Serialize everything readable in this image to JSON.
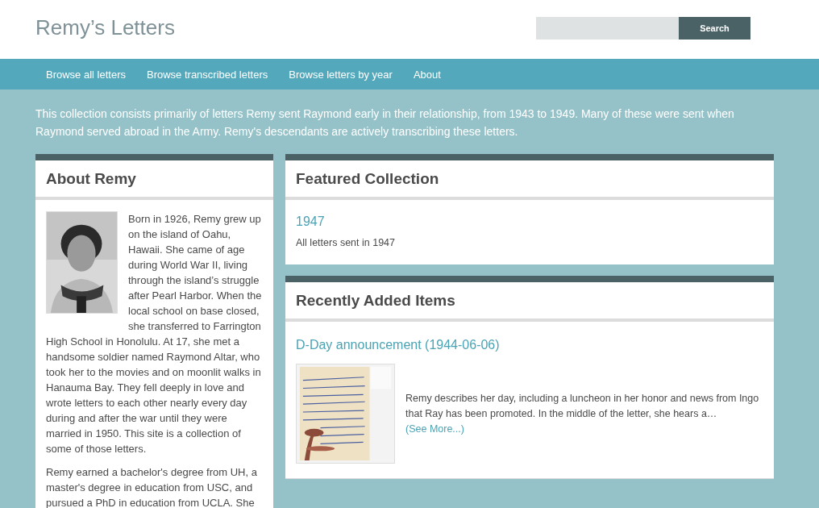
{
  "header": {
    "site_title": "Remy’s Letters",
    "search": {
      "button": "Search"
    }
  },
  "nav": [
    {
      "label": "Browse all letters"
    },
    {
      "label": "Browse transcribed letters"
    },
    {
      "label": "Browse letters by year"
    },
    {
      "label": "About"
    }
  ],
  "intro": "This collection consists primarily of letters Remy sent Raymond early in their relationship, from 1943 to 1949. Many of these were sent when Raymond served abroad in the Army. Remy's descendants are actively transcribing these letters.",
  "about": {
    "title": "About Remy",
    "beside_photo": "Born in 1926, Remy grew up on the island of Oahu, Hawaii. She came of age during World War II, living through the island’s struggle after Pearl Harbor. When the local school on base closed, she transferred to Farrington",
    "paragraphs": [
      "High School in Honolulu. At 17, she met a handsome soldier named Raymond Altar, who took her to the movies and on moonlit walks in Hanauma Bay. They fell deeply in love and wrote letters to each other nearly every day during and after the war until they were married in 1950. This site is a collection of some of those letters.",
      "Remy earned a bachelor's degree from UH, a master's degree in education from USC, and pursued a PhD in education from UCLA. She"
    ]
  },
  "featured": {
    "title": "Featured Collection",
    "collection": {
      "name": "1947",
      "description": "All letters sent in 1947"
    }
  },
  "recent": {
    "title": "Recently Added Items",
    "items": [
      {
        "title": "D-Day announcement (1944-06-06)",
        "description": "Remy describes her day, including a luncheon in her honor and news from Ingo that Ray has been promoted. In the middle of the letter, she hears a…",
        "more": "(See More...)"
      }
    ]
  }
}
